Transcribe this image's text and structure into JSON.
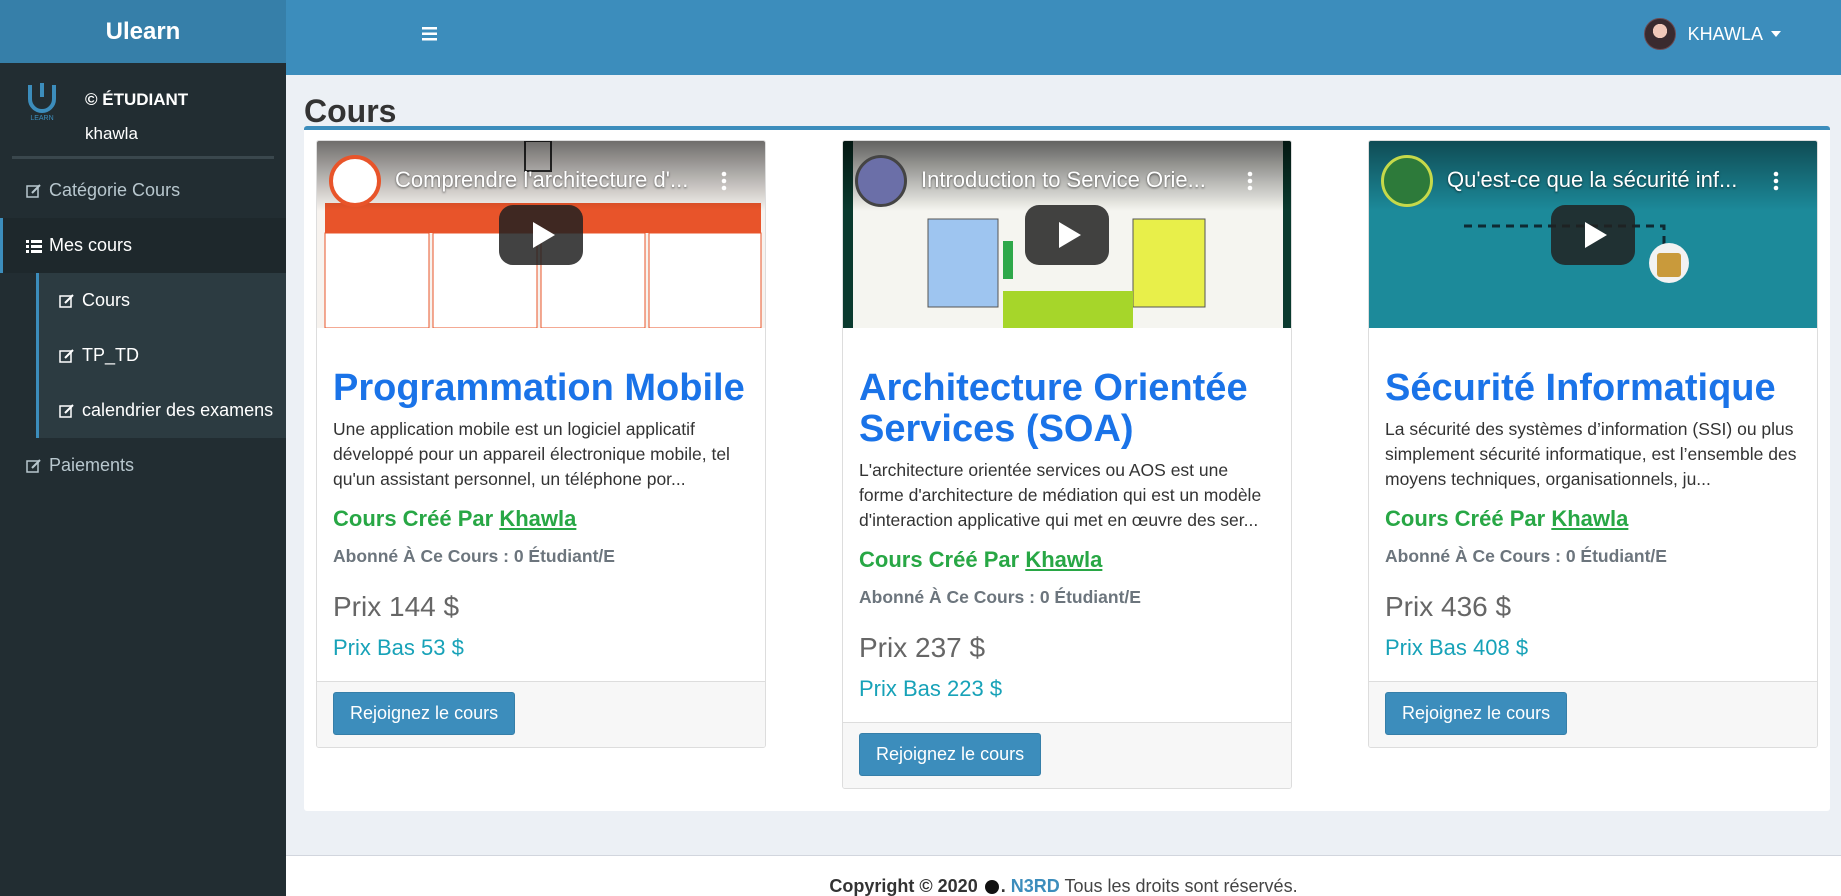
{
  "app": {
    "brand": "Ulearn"
  },
  "user": {
    "role": "© ÉTUDIANT",
    "name": "khawla",
    "header_name": "KHAWLA"
  },
  "sidebar": {
    "items": [
      {
        "label": "Catégorie Cours",
        "icon": "edit-icon"
      },
      {
        "label": "Mes cours",
        "icon": "list-icon"
      },
      {
        "label": "Paiements",
        "icon": "edit-icon"
      }
    ],
    "subitems": [
      {
        "label": "Cours",
        "icon": "edit-icon"
      },
      {
        "label": "TP_TD",
        "icon": "edit-icon"
      },
      {
        "label": "calendrier des examens",
        "icon": "edit-icon"
      }
    ]
  },
  "page": {
    "title": "Cours"
  },
  "courses": [
    {
      "video_title": "Comprendre l'architecture d'...",
      "title": "Programmation Mobile",
      "description": "Une application mobile est un logiciel applicatif développé pour un appareil électronique mobile, tel qu'un assistant personnel, un téléphone por...",
      "author_prefix": "Cours Créé Par",
      "author": "Khawla",
      "subscribers": "Abonné À Ce Cours : 0 Étudiant/E",
      "price": "Prix 144 $",
      "low_price": "Prix Bas 53 $",
      "button": "Rejoignez le cours"
    },
    {
      "video_title": "Introduction to Service Orie...",
      "title": "Architecture Orientée Services (SOA)",
      "description": "L'architecture orientée services ou AOS est une forme d'architecture de médiation qui est un modèle d'interaction applicative qui met en œuvre des ser...",
      "author_prefix": "Cours Créé Par",
      "author": "Khawla",
      "subscribers": "Abonné À Ce Cours : 0 Étudiant/E",
      "price": "Prix 237 $",
      "low_price": "Prix Bas 223 $",
      "button": "Rejoignez le cours"
    },
    {
      "video_title": "Qu'est-ce que la sécurité inf...",
      "title": "Sécurité Informatique",
      "description": "La sécurité des systèmes d’information (SSI) ou plus simplement sécurité informatique, est l’ensemble des moyens techniques, organisationnels, ju...",
      "author_prefix": "Cours Créé Par",
      "author": "Khawla",
      "subscribers": "Abonné À Ce Cours : 0 Étudiant/E",
      "price": "Prix 436 $",
      "low_price": "Prix Bas 408 $",
      "button": "Rejoignez le cours"
    }
  ],
  "footer": {
    "copyright": "Copyright © 2020",
    "brand": "N3RD",
    "rights": "Tous les droits sont réservés."
  },
  "colors": {
    "header": "#3c8dbc",
    "sidebar": "#222d32",
    "title": "#1a73e8",
    "author": "#28a745",
    "low_price": "#17a2b8"
  }
}
